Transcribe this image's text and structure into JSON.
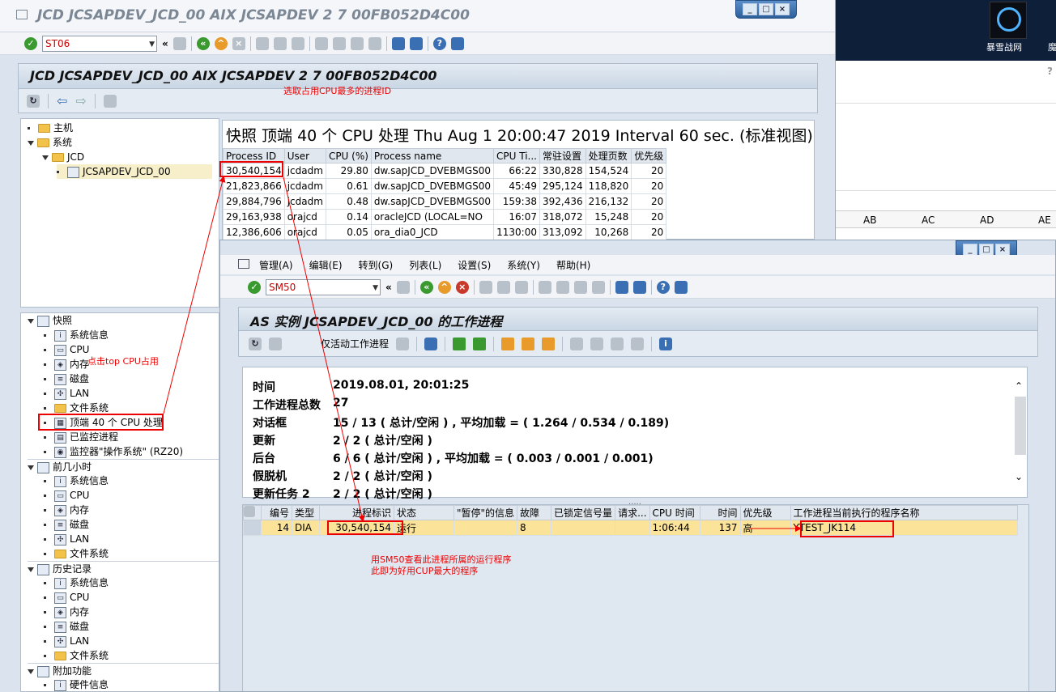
{
  "desktop": {
    "icon_label": "暴雪战网",
    "icon2_label": "魔",
    "help_mark": "?"
  },
  "sheet": {
    "cols": [
      "AB",
      "AC",
      "AD",
      "AE"
    ]
  },
  "w1": {
    "title": "JCD JCSAPDEV_JCD_00 AIX JCSAPDEV 2 7 00FB052D4C00",
    "command": "ST06",
    "header_title": "JCD JCSAPDEV_JCD_00 AIX JCSAPDEV 2 7 00FB052D4C00",
    "snapshot_title": "快照 顶端 40 个 CPU 处理 Thu Aug  1 20:00:47 2019 Interval 60 sec. (标准视图)",
    "top_tree": [
      {
        "label": "主机",
        "kind": "dot-folder",
        "indent": 0
      },
      {
        "label": "系统",
        "kind": "tri-folder",
        "indent": 0
      },
      {
        "label": "JCD",
        "kind": "tri-folder",
        "indent": 1
      },
      {
        "label": "JCSAPDEV_JCD_00",
        "kind": "dot-server",
        "indent": 2
      }
    ],
    "columns": [
      "Process ID",
      "User",
      "CPU (%)",
      "Process name",
      "CPU Ti...",
      "常驻设置",
      "处理页数",
      "优先级"
    ],
    "rows": [
      [
        "30,540,154",
        "jcdadm",
        "29.80",
        "dw.sapJCD_DVEBMGS00",
        "66:22",
        "330,828",
        "154,524",
        "20"
      ],
      [
        "21,823,866",
        "jcdadm",
        "0.61",
        "dw.sapJCD_DVEBMGS00",
        "45:49",
        "295,124",
        "118,820",
        "20"
      ],
      [
        "29,884,796",
        "jcdadm",
        "0.48",
        "dw.sapJCD_DVEBMGS00",
        "159:38",
        "392,436",
        "216,132",
        "20"
      ],
      [
        "29,163,938",
        "orajcd",
        "0.14",
        "oracleJCD (LOCAL=NO",
        "16:07",
        "318,072",
        "15,248",
        "20"
      ],
      [
        "12,386,606",
        "orajcd",
        "0.05",
        "ora_dia0_JCD",
        "1130:00",
        "313,092",
        "10,268",
        "20"
      ]
    ],
    "nav_tree": [
      {
        "label": "快照",
        "kind": "tri-head"
      },
      {
        "label": "系统信息",
        "kind": "item",
        "icon": "i"
      },
      {
        "label": "CPU",
        "kind": "item",
        "icon": "▭"
      },
      {
        "label": "内存",
        "kind": "item",
        "icon": "◈"
      },
      {
        "label": "磁盘",
        "kind": "item",
        "icon": "≡"
      },
      {
        "label": "LAN",
        "kind": "item",
        "icon": "✣"
      },
      {
        "label": "文件系统",
        "kind": "item-folder"
      },
      {
        "label": "顶端 40 个 CPU 处理",
        "kind": "item",
        "icon": "▦",
        "selected": true
      },
      {
        "label": "已监控进程",
        "kind": "item",
        "icon": "▤"
      },
      {
        "label": "监控器\"操作系统\" (RZ20)",
        "kind": "item",
        "icon": "◉"
      },
      {
        "label": "前几小时",
        "kind": "tri-head"
      },
      {
        "label": "系统信息",
        "kind": "item",
        "icon": "i"
      },
      {
        "label": "CPU",
        "kind": "item",
        "icon": "▭"
      },
      {
        "label": "内存",
        "kind": "item",
        "icon": "◈"
      },
      {
        "label": "磁盘",
        "kind": "item",
        "icon": "≡"
      },
      {
        "label": "LAN",
        "kind": "item",
        "icon": "✣"
      },
      {
        "label": "文件系统",
        "kind": "item-folder"
      },
      {
        "label": "历史记录",
        "kind": "tri-head"
      },
      {
        "label": "系统信息",
        "kind": "item",
        "icon": "i"
      },
      {
        "label": "CPU",
        "kind": "item",
        "icon": "▭"
      },
      {
        "label": "内存",
        "kind": "item",
        "icon": "◈"
      },
      {
        "label": "磁盘",
        "kind": "item",
        "icon": "≡"
      },
      {
        "label": "LAN",
        "kind": "item",
        "icon": "✣"
      },
      {
        "label": "文件系统",
        "kind": "item-folder"
      },
      {
        "label": "附加功能",
        "kind": "tri-head"
      },
      {
        "label": "硬件信息",
        "kind": "item",
        "icon": "i"
      }
    ]
  },
  "w2": {
    "menu": [
      "管理(A)",
      "编辑(E)",
      "转到(G)",
      "列表(L)",
      "设置(S)",
      "系统(Y)",
      "帮助(H)"
    ],
    "command": "SM50",
    "header_title": "AS 实例 JCSAPDEV_JCD_00 的工作进程",
    "active_only": "仅活动工作进程",
    "status": [
      {
        "k": "时间",
        "v": "2019.08.01, 20:01:25"
      },
      {
        "k": "工作进程总数",
        "v": "27"
      },
      {
        "k": "对话框",
        "v": "15 / 13 ( 总计/空闲 ) , 平均加载 = ( 1.264 / 0.534 / 0.189)"
      },
      {
        "k": "更新",
        "v": "2 / 2 ( 总计/空闲 )"
      },
      {
        "k": "后台",
        "v": "6 / 6 ( 总计/空闲 ) , 平均加载 = ( 0.003 / 0.001 / 0.001)"
      },
      {
        "k": "假脱机",
        "v": "2 / 2 ( 总计/空闲 )"
      },
      {
        "k": "更新任务 2",
        "v": "2 / 2 ( 总计/空闲 )"
      }
    ],
    "columns": [
      "编号",
      "类型",
      "进程标识",
      "状态",
      "\"暂停\"的信息",
      "故障",
      "已锁定信号量",
      "请求...",
      "CPU 时间",
      "时间",
      "优先级",
      "工作进程当前执行的程序名称"
    ],
    "row": [
      "14",
      "DIA",
      "30,540,154",
      "运行",
      "",
      "8",
      "",
      "",
      "1:06:44",
      "137",
      "高",
      "YTEST_JK114"
    ]
  },
  "notes": {
    "n1": "选取占用CPU最多的进程ID",
    "n2": "点击top CPU占用",
    "n3": "用SM50查看此进程所属的运行程序",
    "n4": "此即为好用CUP最大的程序"
  }
}
